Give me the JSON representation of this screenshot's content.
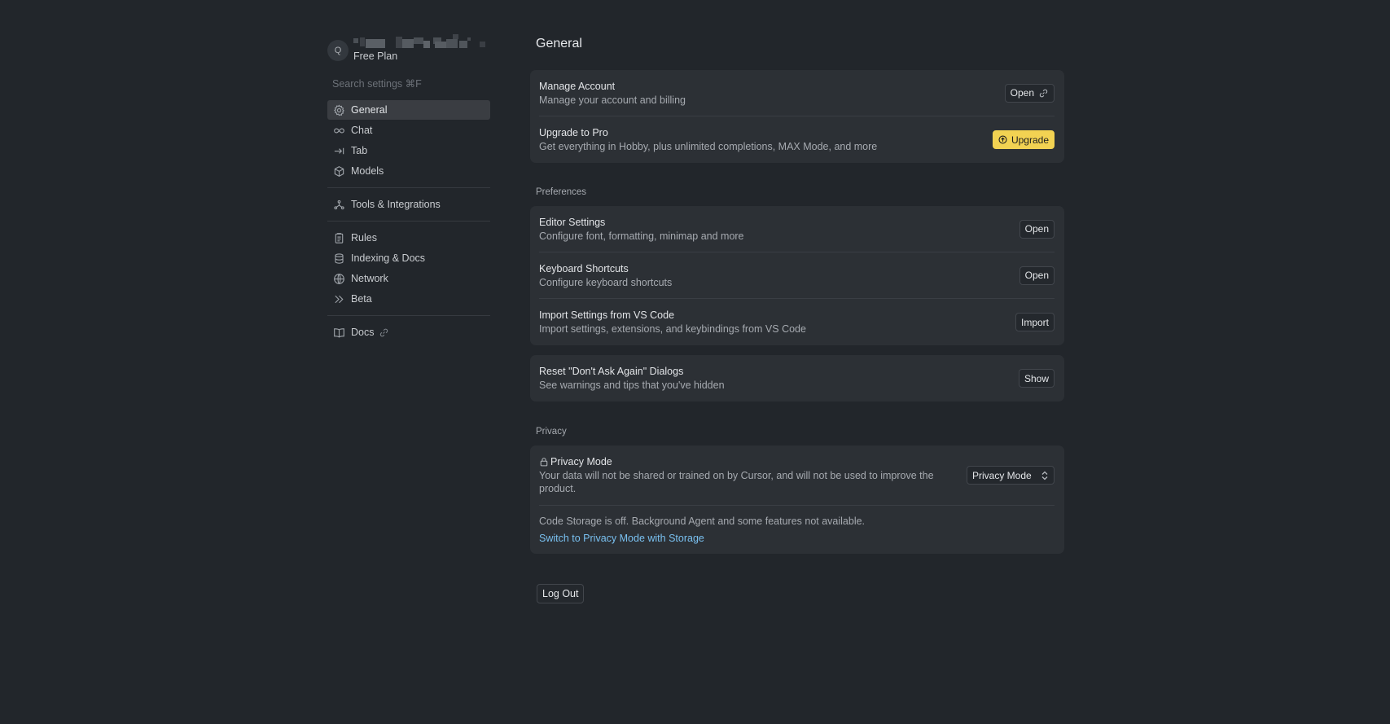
{
  "profile": {
    "avatar_letter": "Q",
    "plan": "Free Plan"
  },
  "search": {
    "placeholder": "Search settings ⌘F"
  },
  "sidebar": {
    "items": [
      {
        "label": "General",
        "icon": "gear-icon",
        "active": true
      },
      {
        "label": "Chat",
        "icon": "infinity-icon"
      },
      {
        "label": "Tab",
        "icon": "arrow-tab-icon"
      },
      {
        "label": "Models",
        "icon": "cube-icon"
      },
      {
        "label": "Tools & Integrations",
        "icon": "network-nodes-icon"
      },
      {
        "label": "Rules",
        "icon": "clipboard-icon"
      },
      {
        "label": "Indexing & Docs",
        "icon": "database-icon"
      },
      {
        "label": "Network",
        "icon": "globe-icon"
      },
      {
        "label": "Beta",
        "icon": "double-chevron-icon"
      },
      {
        "label": "Docs",
        "icon": "book-icon"
      }
    ]
  },
  "main": {
    "title": "General",
    "account": {
      "manage_title": "Manage Account",
      "manage_desc": "Manage your account and billing",
      "manage_btn": "Open",
      "upgrade_title": "Upgrade to Pro",
      "upgrade_desc": "Get everything in Hobby, plus unlimited completions, MAX Mode, and more",
      "upgrade_btn": "Upgrade"
    },
    "preferences": {
      "label": "Preferences",
      "editor_title": "Editor Settings",
      "editor_desc": "Configure font, formatting, minimap and more",
      "editor_btn": "Open",
      "keyboard_title": "Keyboard Shortcuts",
      "keyboard_desc": "Configure keyboard shortcuts",
      "keyboard_btn": "Open",
      "import_title": "Import Settings from VS Code",
      "import_desc": "Import settings, extensions, and keybindings from VS Code",
      "import_btn": "Import"
    },
    "reset": {
      "title": "Reset \"Don't Ask Again\" Dialogs",
      "desc": "See warnings and tips that you've hidden",
      "btn": "Show"
    },
    "privacy": {
      "label": "Privacy",
      "title": "Privacy Mode",
      "desc_line1": "Your data will not be shared or trained on by Cursor, and will not be used to improve the",
      "desc_line2": "product.",
      "select_value": "Privacy Mode",
      "storage_note": "Code Storage is off. Background Agent and some features not available.",
      "storage_link": "Switch to Privacy Mode with Storage"
    },
    "logout_btn": "Log Out"
  },
  "colors": {
    "background": "#22262b",
    "card": "#2c3035",
    "accent_upgrade": "#f2d252",
    "link": "#79c0f0"
  }
}
